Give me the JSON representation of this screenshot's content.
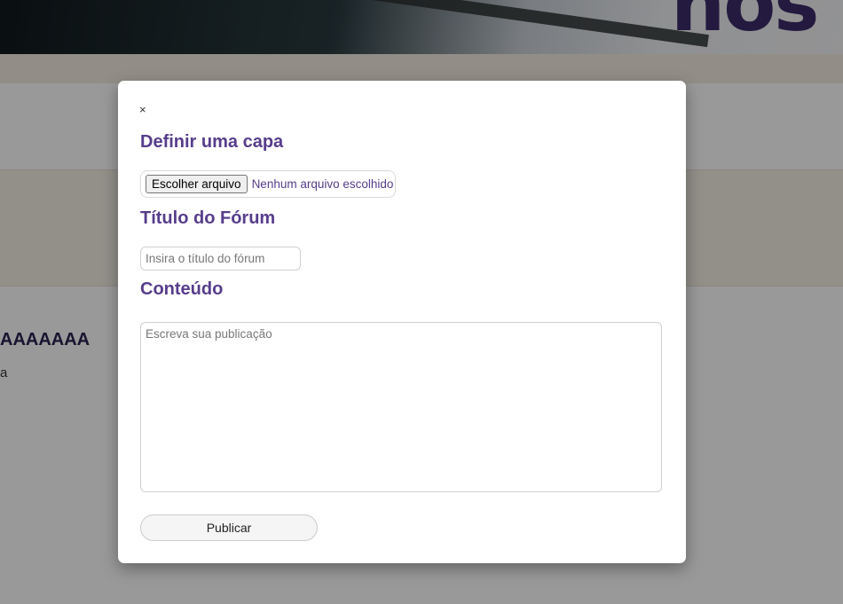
{
  "background": {
    "logo_text": "nos",
    "post_title": "AAAAAAA",
    "post_text": "a"
  },
  "modal": {
    "close_label": "×",
    "cover": {
      "heading": "Definir uma capa",
      "file_button_label": "Escolher arquivo",
      "file_status": "Nenhum arquivo escolhido"
    },
    "forum_title": {
      "heading": "Título do Fórum",
      "placeholder": "Insira o título do fórum",
      "value": ""
    },
    "content": {
      "heading": "Conteúdo",
      "placeholder": "Escreva sua publicação",
      "value": ""
    },
    "publish_label": "Publicar"
  },
  "colors": {
    "accent": "#573d8c",
    "overlay": "rgba(0,0,0,0.40)"
  }
}
